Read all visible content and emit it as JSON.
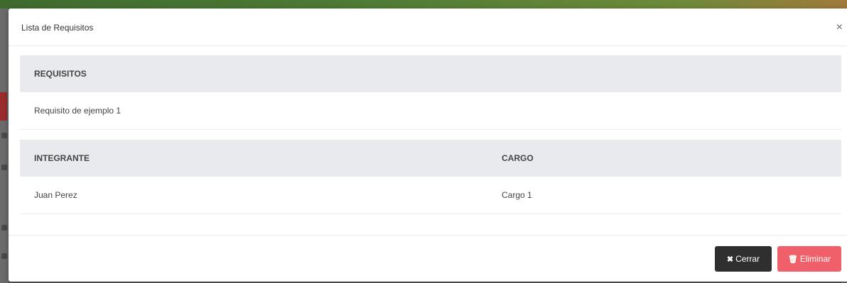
{
  "modal": {
    "title": "Lista de Requisitos",
    "close_icon": "×"
  },
  "requisitos": {
    "header": "REQUISITOS",
    "rows": [
      "Requisito de ejemplo 1"
    ]
  },
  "integrantes": {
    "headers": [
      "INTEGRANTE",
      "CARGO"
    ],
    "rows": [
      {
        "integrante": "Juan Perez",
        "cargo": "Cargo 1"
      }
    ]
  },
  "footer": {
    "cerrar_icon": "✖",
    "cerrar_label": "Cerrar",
    "eliminar_icon": "🗑",
    "eliminar_label": "Eliminar"
  },
  "colors": {
    "cerrar_bg": "#2f2f2f",
    "eliminar_bg": "#f0606a",
    "table_header_bg": "#e8eaee"
  }
}
